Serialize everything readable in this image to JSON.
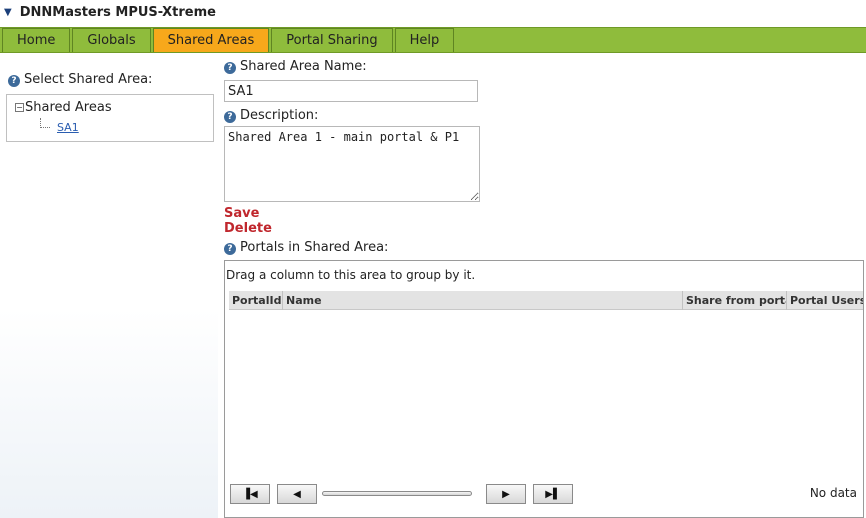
{
  "module": {
    "title": "DNNMasters MPUS-Xtreme"
  },
  "tabs": [
    {
      "label": "Home",
      "active": false
    },
    {
      "label": "Globals",
      "active": false
    },
    {
      "label": "Shared Areas",
      "active": true
    },
    {
      "label": "Portal Sharing",
      "active": false
    },
    {
      "label": "Help",
      "active": false
    }
  ],
  "colors": {
    "tab_bar": "#8fbc3c",
    "active_tab": "#f7a81b",
    "action_link": "#c0272d"
  },
  "sidebar": {
    "label": "Select Shared Area:",
    "tree": {
      "root": "Shared Areas",
      "children": [
        "SA1"
      ]
    }
  },
  "form": {
    "name_label": "Shared Area Name:",
    "name_value": "SA1",
    "description_label": "Description:",
    "description_value": "Shared Area 1 - main portal & P1",
    "save_label": "Save",
    "delete_label": "Delete",
    "portals_label": "Portals in Shared Area:"
  },
  "grid": {
    "group_hint": "Drag a column to this area to group by it.",
    "columns": [
      "PortalId",
      "Name",
      "Share from porta",
      "Portal Users"
    ],
    "rows": [],
    "empty_text": "No data"
  }
}
